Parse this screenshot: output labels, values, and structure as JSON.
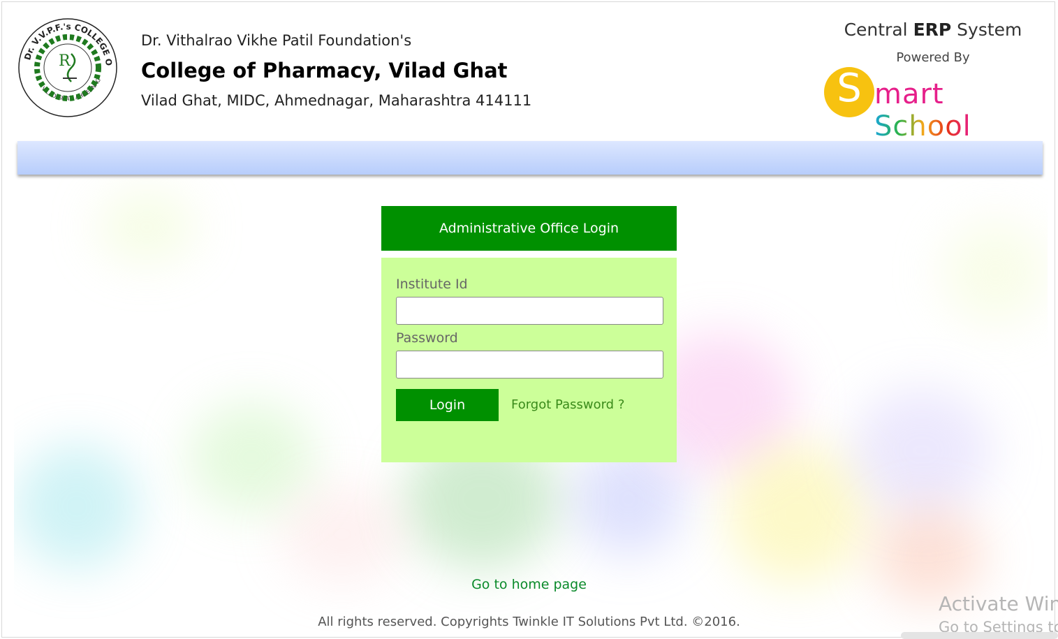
{
  "header": {
    "foundation": "Dr. Vithalrao Vikhe Patil Foundation's",
    "college": "College of Pharmacy, Vilad Ghat",
    "address": "Vilad Ghat, MIDC, Ahmednagar, Maharashtra 414111",
    "logo_seal_text": "Dr. VVPF's COLLEGE OF PHARMACY · VILAD GHAT, AHMEDNAGAR"
  },
  "erp": {
    "central": "Central",
    "erp": "ERP",
    "system": "System",
    "powered_by": "Powered By",
    "brand_letter": "S",
    "brand_mart": "mart",
    "brand_school": "School"
  },
  "login": {
    "title": "Administrative Office Login",
    "institute_label": "Institute Id",
    "institute_value": "",
    "password_label": "Password",
    "password_value": "",
    "login_button": "Login",
    "forgot_link": "Forgot Password ?"
  },
  "footer": {
    "home_link": "Go to home page",
    "copyright": "All rights reserved. Copyrights Twinkle IT Solutions Pvt Ltd. ©2016."
  },
  "watermark": {
    "line1": "Activate Windows",
    "line2": "Go to Settings to activate Windows."
  },
  "colors": {
    "login_green": "#009000",
    "panel_green": "#ccff99",
    "bar_blue": "#c4d6fd",
    "brand_yellow": "#f7c210"
  }
}
